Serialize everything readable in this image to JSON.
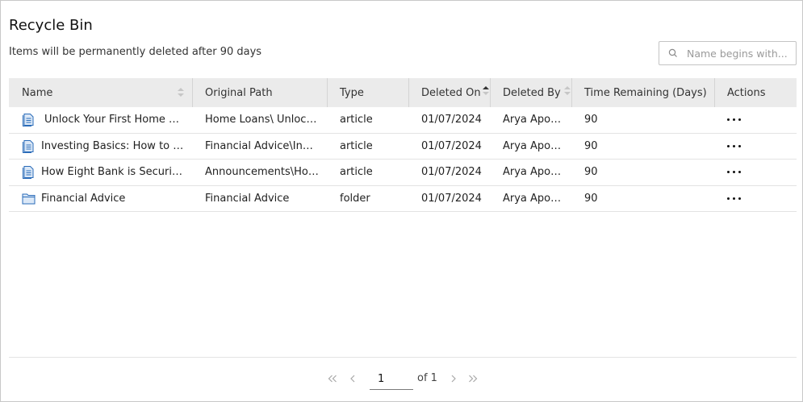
{
  "page": {
    "title": "Recycle Bin",
    "subtitle": "Items will be permanently deleted after 90 days"
  },
  "search": {
    "placeholder": "Name begins with...",
    "icon": "search-icon"
  },
  "table": {
    "columns": [
      "Name",
      "Original Path",
      "Type",
      "Deleted On",
      "Deleted By",
      "Time Remaining (Days)",
      "Actions"
    ],
    "rows": [
      {
        "icon": "article-icon",
        "name": "Unlock Your First Home with Ease",
        "path": "Home Loans\\ Unlock Your First Home",
        "type": "article",
        "deleted_on": "01/07/2024",
        "deleted_by": "Arya Apoorva",
        "remaining": "90"
      },
      {
        "icon": "article-icon",
        "name": "Investing Basics: How to Start",
        "path": "Financial Advice\\Investing Basics",
        "type": "article",
        "deleted_on": "01/07/2024",
        "deleted_by": "Arya Apoorva",
        "remaining": "90"
      },
      {
        "icon": "article-icon",
        "name": "How Eight Bank is Securing Your Data",
        "path": "Announcements\\How Eight Bank",
        "type": "article",
        "deleted_on": "01/07/2024",
        "deleted_by": "Arya Apoorva",
        "remaining": "90"
      },
      {
        "icon": "folder-icon",
        "name": "Financial Advice",
        "path": "Financial Advice",
        "type": "folder",
        "deleted_on": "01/07/2024",
        "deleted_by": "Arya Apoorva",
        "remaining": "90"
      }
    ]
  },
  "pagination": {
    "current_page": "1",
    "of_label": "of 1"
  },
  "colors": {
    "header_bg": "#ebebeb",
    "icon_blue": "#2a6bb8"
  }
}
